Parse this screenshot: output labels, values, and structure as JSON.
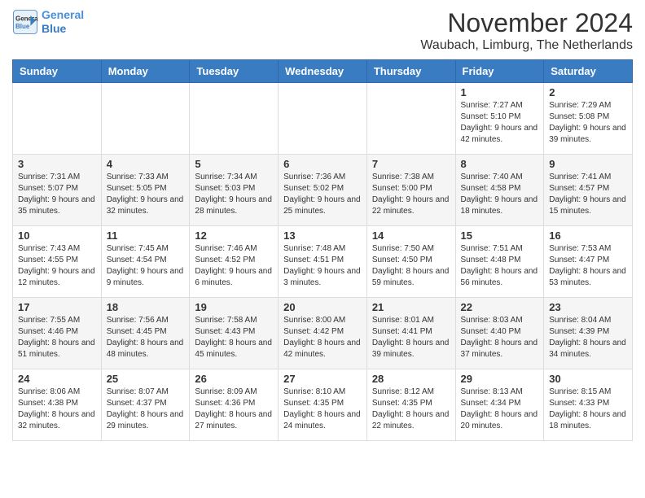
{
  "logo": {
    "line1": "General",
    "line2": "Blue"
  },
  "title": "November 2024",
  "location": "Waubach, Limburg, The Netherlands",
  "weekdays": [
    "Sunday",
    "Monday",
    "Tuesday",
    "Wednesday",
    "Thursday",
    "Friday",
    "Saturday"
  ],
  "weeks": [
    [
      {
        "day": "",
        "info": ""
      },
      {
        "day": "",
        "info": ""
      },
      {
        "day": "",
        "info": ""
      },
      {
        "day": "",
        "info": ""
      },
      {
        "day": "",
        "info": ""
      },
      {
        "day": "1",
        "info": "Sunrise: 7:27 AM\nSunset: 5:10 PM\nDaylight: 9 hours and 42 minutes."
      },
      {
        "day": "2",
        "info": "Sunrise: 7:29 AM\nSunset: 5:08 PM\nDaylight: 9 hours and 39 minutes."
      }
    ],
    [
      {
        "day": "3",
        "info": "Sunrise: 7:31 AM\nSunset: 5:07 PM\nDaylight: 9 hours and 35 minutes."
      },
      {
        "day": "4",
        "info": "Sunrise: 7:33 AM\nSunset: 5:05 PM\nDaylight: 9 hours and 32 minutes."
      },
      {
        "day": "5",
        "info": "Sunrise: 7:34 AM\nSunset: 5:03 PM\nDaylight: 9 hours and 28 minutes."
      },
      {
        "day": "6",
        "info": "Sunrise: 7:36 AM\nSunset: 5:02 PM\nDaylight: 9 hours and 25 minutes."
      },
      {
        "day": "7",
        "info": "Sunrise: 7:38 AM\nSunset: 5:00 PM\nDaylight: 9 hours and 22 minutes."
      },
      {
        "day": "8",
        "info": "Sunrise: 7:40 AM\nSunset: 4:58 PM\nDaylight: 9 hours and 18 minutes."
      },
      {
        "day": "9",
        "info": "Sunrise: 7:41 AM\nSunset: 4:57 PM\nDaylight: 9 hours and 15 minutes."
      }
    ],
    [
      {
        "day": "10",
        "info": "Sunrise: 7:43 AM\nSunset: 4:55 PM\nDaylight: 9 hours and 12 minutes."
      },
      {
        "day": "11",
        "info": "Sunrise: 7:45 AM\nSunset: 4:54 PM\nDaylight: 9 hours and 9 minutes."
      },
      {
        "day": "12",
        "info": "Sunrise: 7:46 AM\nSunset: 4:52 PM\nDaylight: 9 hours and 6 minutes."
      },
      {
        "day": "13",
        "info": "Sunrise: 7:48 AM\nSunset: 4:51 PM\nDaylight: 9 hours and 3 minutes."
      },
      {
        "day": "14",
        "info": "Sunrise: 7:50 AM\nSunset: 4:50 PM\nDaylight: 8 hours and 59 minutes."
      },
      {
        "day": "15",
        "info": "Sunrise: 7:51 AM\nSunset: 4:48 PM\nDaylight: 8 hours and 56 minutes."
      },
      {
        "day": "16",
        "info": "Sunrise: 7:53 AM\nSunset: 4:47 PM\nDaylight: 8 hours and 53 minutes."
      }
    ],
    [
      {
        "day": "17",
        "info": "Sunrise: 7:55 AM\nSunset: 4:46 PM\nDaylight: 8 hours and 51 minutes."
      },
      {
        "day": "18",
        "info": "Sunrise: 7:56 AM\nSunset: 4:45 PM\nDaylight: 8 hours and 48 minutes."
      },
      {
        "day": "19",
        "info": "Sunrise: 7:58 AM\nSunset: 4:43 PM\nDaylight: 8 hours and 45 minutes."
      },
      {
        "day": "20",
        "info": "Sunrise: 8:00 AM\nSunset: 4:42 PM\nDaylight: 8 hours and 42 minutes."
      },
      {
        "day": "21",
        "info": "Sunrise: 8:01 AM\nSunset: 4:41 PM\nDaylight: 8 hours and 39 minutes."
      },
      {
        "day": "22",
        "info": "Sunrise: 8:03 AM\nSunset: 4:40 PM\nDaylight: 8 hours and 37 minutes."
      },
      {
        "day": "23",
        "info": "Sunrise: 8:04 AM\nSunset: 4:39 PM\nDaylight: 8 hours and 34 minutes."
      }
    ],
    [
      {
        "day": "24",
        "info": "Sunrise: 8:06 AM\nSunset: 4:38 PM\nDaylight: 8 hours and 32 minutes."
      },
      {
        "day": "25",
        "info": "Sunrise: 8:07 AM\nSunset: 4:37 PM\nDaylight: 8 hours and 29 minutes."
      },
      {
        "day": "26",
        "info": "Sunrise: 8:09 AM\nSunset: 4:36 PM\nDaylight: 8 hours and 27 minutes."
      },
      {
        "day": "27",
        "info": "Sunrise: 8:10 AM\nSunset: 4:35 PM\nDaylight: 8 hours and 24 minutes."
      },
      {
        "day": "28",
        "info": "Sunrise: 8:12 AM\nSunset: 4:35 PM\nDaylight: 8 hours and 22 minutes."
      },
      {
        "day": "29",
        "info": "Sunrise: 8:13 AM\nSunset: 4:34 PM\nDaylight: 8 hours and 20 minutes."
      },
      {
        "day": "30",
        "info": "Sunrise: 8:15 AM\nSunset: 4:33 PM\nDaylight: 8 hours and 18 minutes."
      }
    ]
  ]
}
